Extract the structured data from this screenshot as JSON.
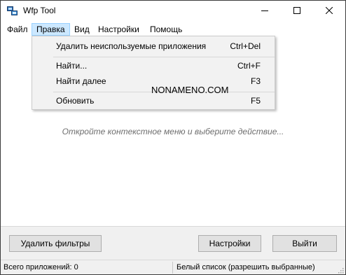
{
  "window": {
    "title": "Wfp Tool",
    "icon": "network-app-icon",
    "controls": {
      "minimize": "minimize-icon",
      "maximize": "maximize-icon",
      "close": "close-icon"
    }
  },
  "menubar": {
    "items": [
      "Файл",
      "Правка",
      "Вид",
      "Настройки",
      "Помощь"
    ],
    "active": "Правка"
  },
  "dropdown": {
    "items": [
      {
        "label": "Удалить неиспользуемые приложения",
        "shortcut": "Ctrl+Del"
      },
      {
        "label": "Найти...",
        "shortcut": "Ctrl+F"
      },
      {
        "label": "Найти далее",
        "shortcut": "F3"
      },
      {
        "label": "Обновить",
        "shortcut": "F5"
      }
    ]
  },
  "watermark": "NONAMENO.COM",
  "main": {
    "hint": "Откройте контекстное меню и выберите действие..."
  },
  "buttons": {
    "remove_filters": "Удалить фильтры",
    "settings": "Настройки",
    "exit": "Выйти"
  },
  "statusbar": {
    "total_apps": "Всего приложений: 0",
    "mode": "Белый список (разрешить выбранные)"
  },
  "colors": {
    "menu_highlight": "#cce8ff",
    "menu_highlight_border": "#99d1ff",
    "dropdown_bg": "#f2f2f2",
    "panel_bg": "#f0f0f0",
    "hint_text": "#6d6d6d"
  }
}
